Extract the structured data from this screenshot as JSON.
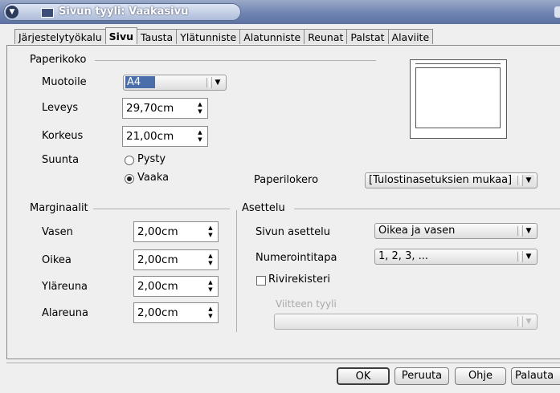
{
  "window": {
    "title": "Sivun tyyli: Vaakasivu"
  },
  "tabs": [
    {
      "label": "Järjestelytyökalu"
    },
    {
      "label": "Sivu"
    },
    {
      "label": "Tausta"
    },
    {
      "label": "Ylätunniste"
    },
    {
      "label": "Alatunniste"
    },
    {
      "label": "Reunat"
    },
    {
      "label": "Palstat"
    },
    {
      "label": "Alaviite"
    }
  ],
  "paper": {
    "section": "Paperikoko",
    "format_label": "Muotoile",
    "format_value": "A4",
    "width_label": "Leveys",
    "width_value": "29,70cm",
    "height_label": "Korkeus",
    "height_value": "21,00cm",
    "orientation_label": "Suunta",
    "portrait_label": "Pysty",
    "landscape_label": "Vaaka",
    "orientation_selected": "Vaaka",
    "tray_label": "Paperilokero",
    "tray_value": "[Tulostinasetuksien mukaa]"
  },
  "margins": {
    "section": "Marginaalit",
    "left_label": "Vasen",
    "left_value": "2,00cm",
    "right_label": "Oikea",
    "right_value": "2,00cm",
    "top_label": "Yläreuna",
    "top_value": "2,00cm",
    "bottom_label": "Alareuna",
    "bottom_value": "2,00cm"
  },
  "layout": {
    "section": "Asettelu",
    "page_layout_label": "Sivun asettelu",
    "page_layout_value": "Oikea ja vasen",
    "numbering_label": "Numerointitapa",
    "numbering_value": "1, 2, 3, ...",
    "register_label": "Rivirekisteri",
    "register_checked": false,
    "reference_label": "Viitteen tyyli",
    "reference_value": ""
  },
  "buttons": {
    "ok": "OK",
    "cancel": "Peruuta",
    "help": "Ohje",
    "reset": "Palauta"
  },
  "colors": {
    "titlebar": "#6f84b2",
    "background": "#efefef",
    "disabled_text": "#a8a8a8"
  }
}
